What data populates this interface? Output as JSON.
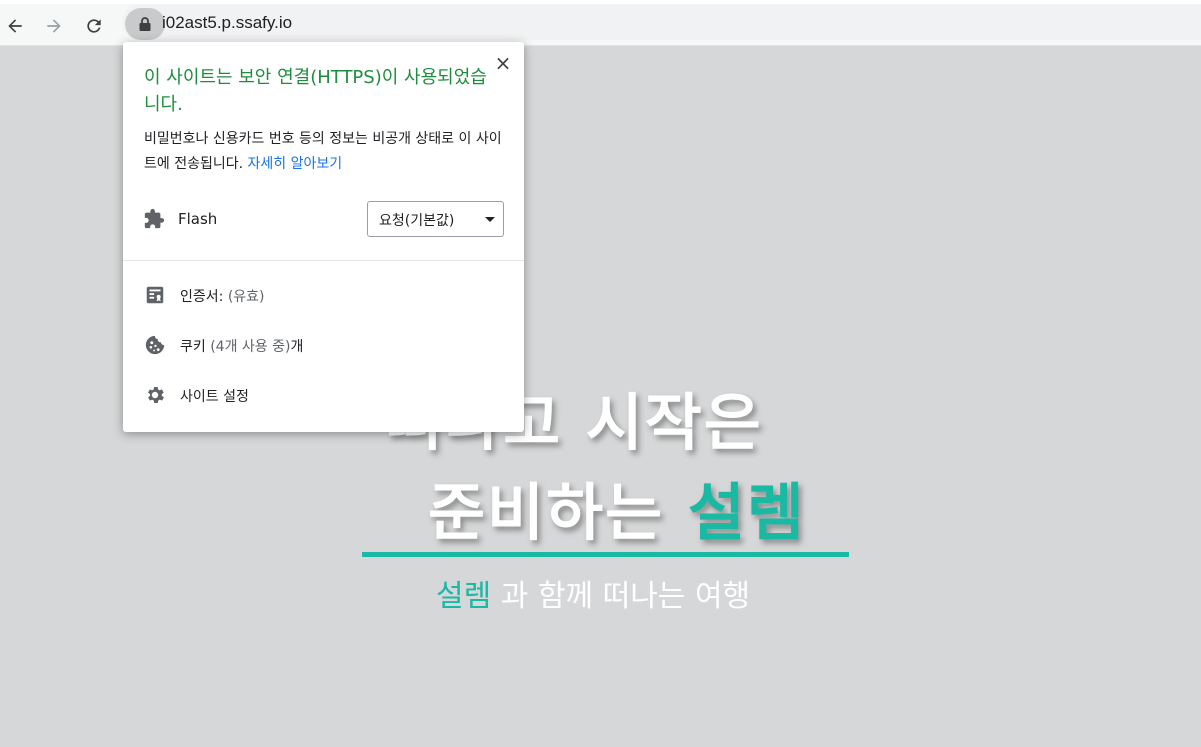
{
  "browser": {
    "url": "i02ast5.p.ssafy.io"
  },
  "page": {
    "hero_line1": "떠나고 시작은",
    "hero_line2_prefix": "준비하는 ",
    "hero_line2_accent": "설렘",
    "subtitle_accent": "설렘",
    "subtitle_rest": " 과 함께 떠나는 여행",
    "accent_color": "#19b9a4"
  },
  "popup": {
    "title": "이 사이트는 보안 연결(HTTPS)이 사용되었습니다.",
    "description": "비밀번호나 신용카드 번호 등의 정보는 비공개 상태로 이 사이트에 전송됩니다. ",
    "learn_more": "자세히 알아보기",
    "close_icon": "×",
    "flash": {
      "icon": "puzzle-icon",
      "label": "Flash",
      "selected_option": "요청(기본값)"
    },
    "menu": [
      {
        "icon": "certificate-icon",
        "label": "인증서: ",
        "detail": "(유효)"
      },
      {
        "icon": "cookie-icon",
        "label": "쿠키 ",
        "detail": "(4개 사용 중)",
        "suffix": "개"
      },
      {
        "icon": "gear-icon",
        "label": "사이트 설정",
        "detail": ""
      }
    ]
  }
}
